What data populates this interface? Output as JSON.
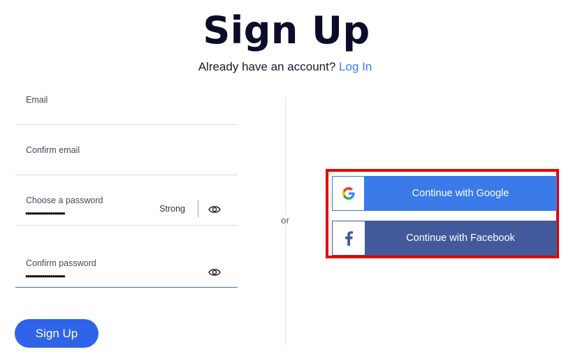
{
  "header": {
    "title": "Sign Up",
    "subtitle": "Already have an account?",
    "login_link": "Log In"
  },
  "form": {
    "email_label": "Email",
    "confirm_email_label": "Confirm email",
    "password_label": "Choose a password",
    "password_value": "•••••••••••••••••••",
    "password_strength": "Strong",
    "confirm_password_label": "Confirm password",
    "confirm_password_value": "•••••••••••••••••••",
    "submit_label": "Sign Up"
  },
  "divider": {
    "label": "or"
  },
  "social": {
    "google_label": "Continue with Google",
    "facebook_label": "Continue with Facebook"
  },
  "colors": {
    "primary": "#2f64e8",
    "link": "#3b7bf0",
    "google": "#3a7ae9",
    "facebook": "#42599b",
    "highlight": "#e60000"
  }
}
